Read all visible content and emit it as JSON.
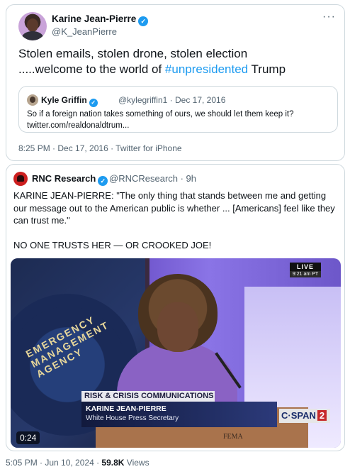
{
  "tweet": {
    "author_name": "Karine Jean-Pierre",
    "author_handle": "@K_JeanPierre",
    "more_label": "···",
    "text_line1": "Stolen emails, stolen drone, stolen election",
    "text_line2_prefix": ".....welcome to the world of ",
    "hashtag": "#unpresidented",
    "text_line2_suffix": " Trump",
    "quote": {
      "author_name": "Kyle Griffin",
      "author_handle": "@kylegriffin1 · Dec 17, 2016",
      "text_line1": "So if a foreign nation takes something of ours, we should let them keep it?",
      "text_line2": "twitter.com/realdonaldtrum..."
    },
    "meta": "8:25 PM · Dec 17, 2016 · Twitter for iPhone"
  },
  "post": {
    "author_name": "RNC Research",
    "author_handle": "@RNCResearch · 9h",
    "paragraph1": "KARINE JEAN-PIERRE: \"The only thing that stands between me and getting our message out to the American public is whether ... [Americans] feel like they can trust me.\"",
    "paragraph2": "NO ONE TRUSTS HER — OR CROOKED JOE!",
    "video": {
      "live_label": "LIVE",
      "live_time": "9:21 am PT",
      "chyron_header": "RISK & CRISIS COMMUNICATIONS",
      "chyron_name": "KARINE JEAN-PIERRE",
      "chyron_title": "White House Press Secretary",
      "network": "C·SPAN",
      "network_number": "2",
      "seal_text": "EMERGENCY MANAGEMENT AGENCY",
      "podium_text": "FEMA",
      "duration": "0:24"
    },
    "meta_time": "5:05 PM · Jun 10, 2024 · ",
    "meta_views": "59.8K",
    "meta_views_label": " Views"
  },
  "icons": {
    "verified": "verified-badge-icon",
    "more": "more-options-icon"
  },
  "colors": {
    "link": "#1d9bf0",
    "secondary_text": "#536471",
    "border": "#cfd9de",
    "rnc_red": "#cc1f1f"
  }
}
